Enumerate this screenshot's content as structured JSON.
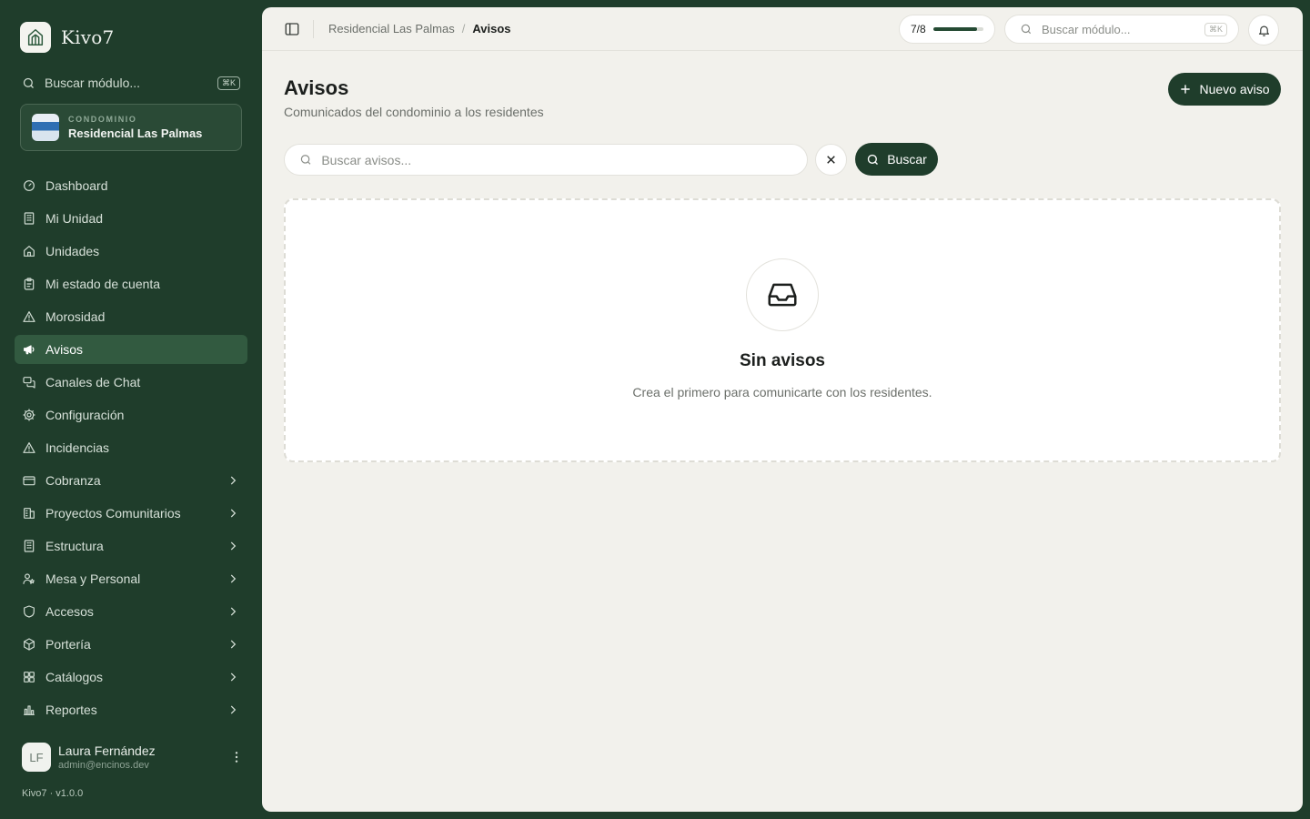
{
  "app": {
    "name": "Kivo7",
    "version": "Kivo7 · v1.0.0"
  },
  "sidebar": {
    "search_placeholder": "Buscar módulo...",
    "search_shortcut": "⌘K",
    "condo": {
      "kicker": "CONDOMINIO",
      "name": "Residencial Las Palmas"
    },
    "items": [
      {
        "label": "Dashboard",
        "icon": "gauge-icon"
      },
      {
        "label": "Mi Unidad",
        "icon": "building-icon"
      },
      {
        "label": "Unidades",
        "icon": "home-icon"
      },
      {
        "label": "Mi estado de cuenta",
        "icon": "clipboard-icon"
      },
      {
        "label": "Morosidad",
        "icon": "warning-icon"
      },
      {
        "label": "Avisos",
        "icon": "megaphone-icon",
        "active": true
      },
      {
        "label": "Canales de Chat",
        "icon": "chat-icon"
      },
      {
        "label": "Configuración",
        "icon": "gear-icon"
      },
      {
        "label": "Incidencias",
        "icon": "warning-icon"
      },
      {
        "label": "Cobranza",
        "icon": "card-icon",
        "expandable": true
      },
      {
        "label": "Proyectos Comunitarios",
        "icon": "project-icon",
        "expandable": true
      },
      {
        "label": "Estructura",
        "icon": "building-icon",
        "expandable": true
      },
      {
        "label": "Mesa y Personal",
        "icon": "staff-icon",
        "expandable": true
      },
      {
        "label": "Accesos",
        "icon": "shield-icon",
        "expandable": true
      },
      {
        "label": "Portería",
        "icon": "box-icon",
        "expandable": true
      },
      {
        "label": "Catálogos",
        "icon": "grid-icon",
        "expandable": true
      },
      {
        "label": "Reportes",
        "icon": "bar-chart-icon",
        "expandable": true
      }
    ],
    "user": {
      "initials": "LF",
      "name": "Laura Fernández",
      "email": "admin@encinos.dev"
    }
  },
  "topbar": {
    "breadcrumb": [
      "Residencial Las Palmas",
      "Avisos"
    ],
    "breadcrumb_sep": "/",
    "progress": {
      "label": "7/8",
      "value": 0.875
    },
    "search_placeholder": "Buscar módulo...",
    "search_shortcut": "⌘K"
  },
  "page": {
    "title": "Avisos",
    "subtitle": "Comunicados del condominio a los residentes",
    "new_button": "Nuevo aviso",
    "search_placeholder": "Buscar avisos...",
    "search_button": "Buscar",
    "empty": {
      "title": "Sin avisos",
      "text": "Crea el primero para comunicarte con los residentes."
    }
  },
  "colors": {
    "sidebar_bg": "#1f3d2b",
    "accent": "#1f3d2b",
    "active_item": "#325a40",
    "panel_bg": "#f2f1ec"
  }
}
